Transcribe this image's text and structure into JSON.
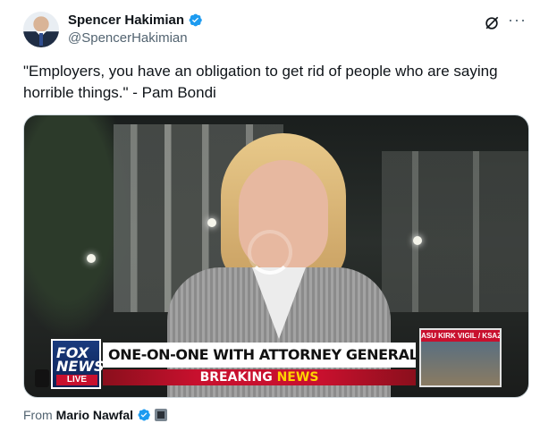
{
  "author": {
    "display_name": "Spencer Hakimian",
    "handle": "@SpencerHakimian",
    "verified": true
  },
  "tweet": {
    "text": "\"Employers, you have an obligation to get rid of people who are saying horrible things.\" - Pam Bondi"
  },
  "media": {
    "chyron_headline": "ONE-ON-ONE WITH ATTORNEY GENERAL PAM BONDI",
    "chyron_breaking": "BREAKING",
    "chyron_news": "NEWS",
    "network_logo_line1": "FOX",
    "network_logo_line2": "NEWS",
    "network_live": "LIVE",
    "inset_label": "ASU KIRK VIGIL / KSAZ"
  },
  "attribution": {
    "prefix": "From",
    "name": "Mario Nawfal",
    "verified": true
  },
  "icons": {
    "grok": "grok-icon",
    "more": "more-icon",
    "verified": "verified-badge-icon",
    "affiliate": "affiliate-badge-icon"
  },
  "colors": {
    "verified_blue": "#1d9bf0",
    "text_primary": "#0f1419",
    "text_secondary": "#536471",
    "fox_red": "#c8102e",
    "fox_blue": "#1a3b7e"
  }
}
